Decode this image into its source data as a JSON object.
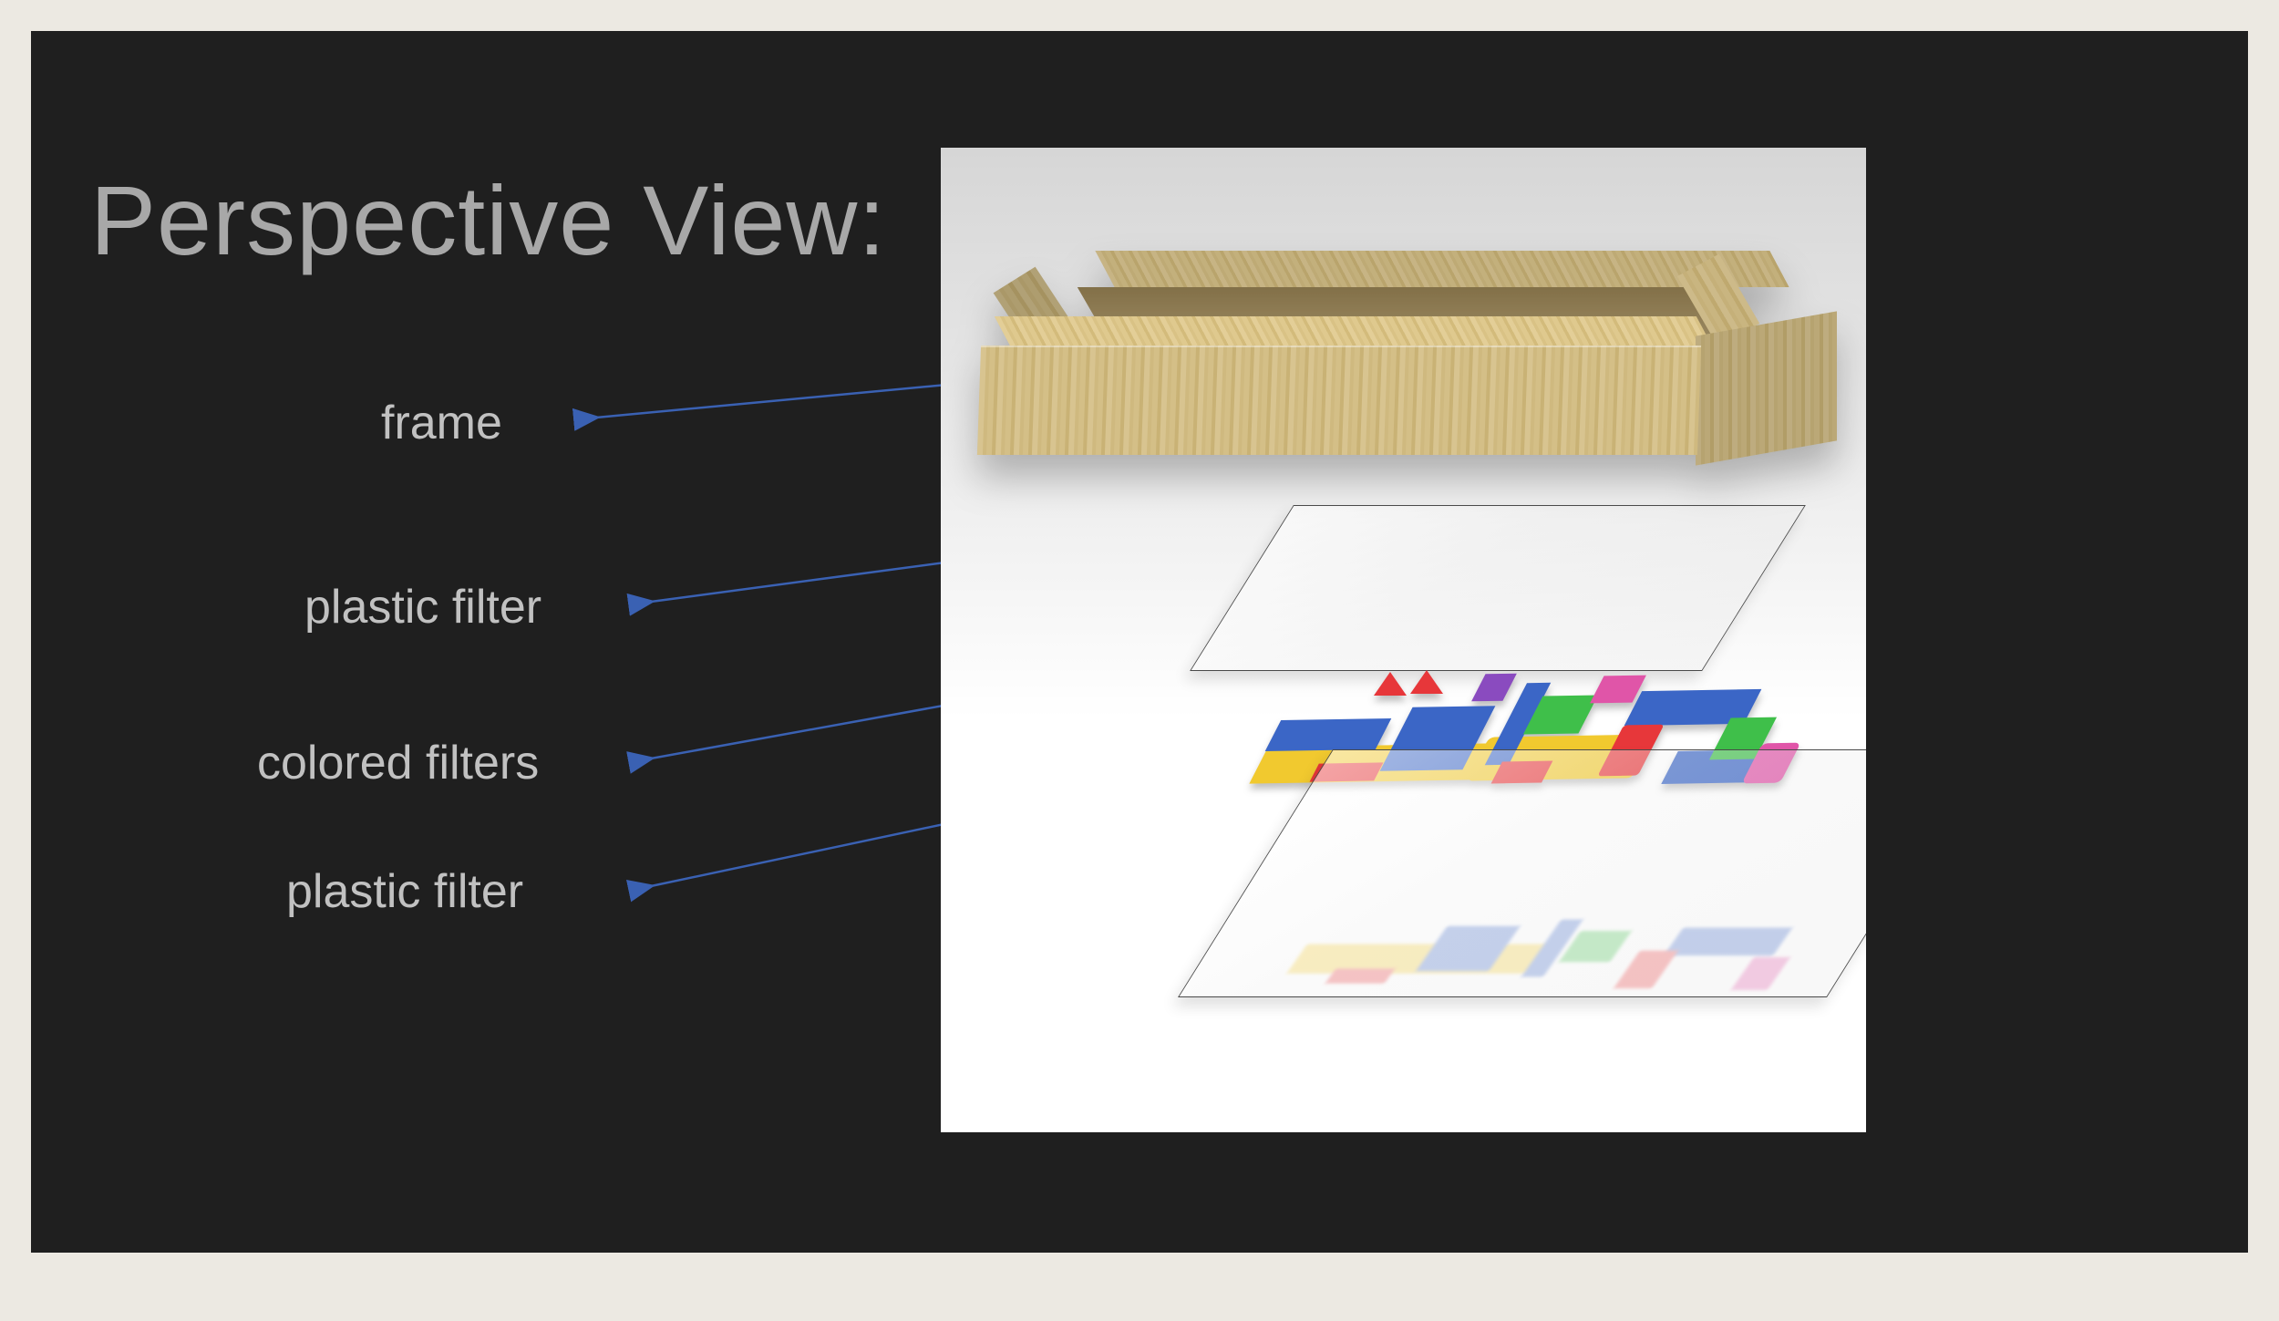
{
  "title": "Perspective View:",
  "labels": {
    "frame": "frame",
    "plastic_filter_top": "plastic filter",
    "colored_filters": "colored filters",
    "plastic_filter_bottom": "plastic filter"
  },
  "colors": {
    "slide_bg": "#1f1f1f",
    "text_title": "#a8a8a8",
    "text_label": "#c1c1c1",
    "arrow": "#3a61b3",
    "wood1": "#d8c490",
    "wood2": "#c9b275",
    "shape_red": "#e7373a",
    "shape_blue": "#3b66c6",
    "shape_yellow": "#f1c92f",
    "shape_green": "#3fbf4a",
    "shape_pink": "#e055a8",
    "shape_violet": "#8a4bbf"
  },
  "layers": [
    {
      "name": "frame",
      "label": "frame"
    },
    {
      "name": "plastic_filter",
      "label": "plastic filter"
    },
    {
      "name": "colored_filters",
      "label": "colored filters"
    },
    {
      "name": "plastic_filter",
      "label": "plastic filter"
    }
  ]
}
